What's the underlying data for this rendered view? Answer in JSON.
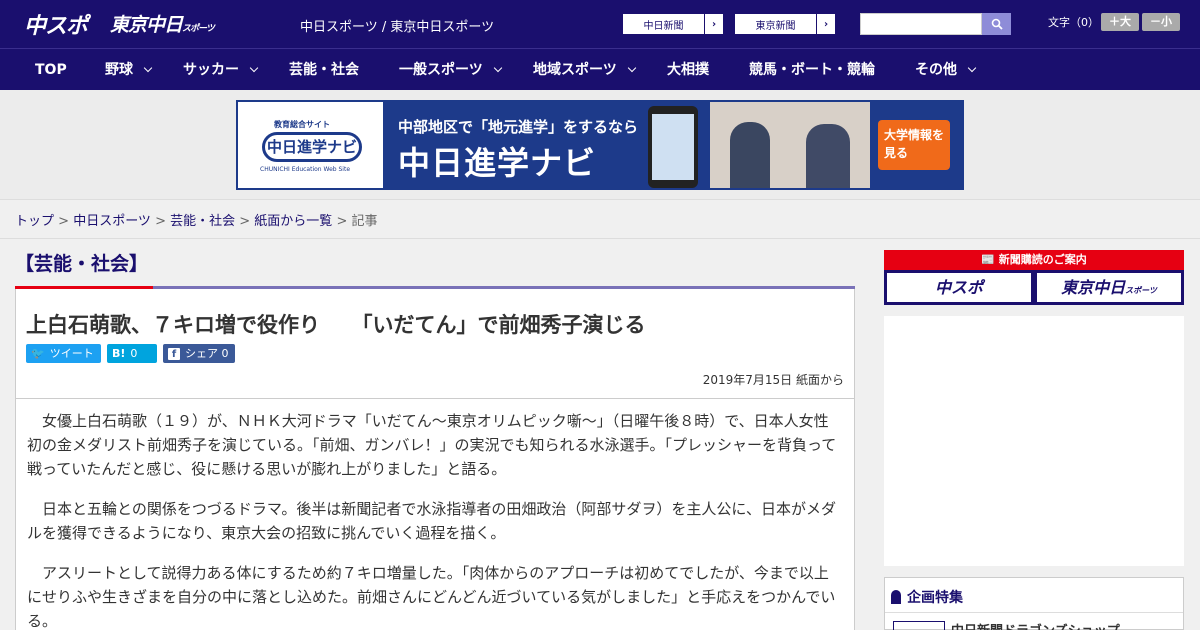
{
  "header": {
    "logo_chuspo": "中スポ",
    "logo_tokyo": "東京中日",
    "logo_tokyo_sub": "スポーツ",
    "site_name": "中日スポーツ / 東京中日スポーツ",
    "partner_links": [
      "中日新聞",
      "東京新聞"
    ],
    "font_size_label": "文字（0）",
    "font_bigger": "＋大",
    "font_smaller": "－小"
  },
  "nav": {
    "items": [
      {
        "label": "TOP"
      },
      {
        "label": "野球"
      },
      {
        "label": "サッカー"
      },
      {
        "label": "芸能・社会"
      },
      {
        "label": "一般スポーツ"
      },
      {
        "label": "地域スポーツ"
      },
      {
        "label": "大相撲"
      },
      {
        "label": "競馬・ボート・競輪"
      },
      {
        "label": "その他"
      }
    ]
  },
  "banner": {
    "logo_top": "教育総合サイト",
    "logo": "中日進学ナビ",
    "logo_sub": "CHUNICHI Education Web Site",
    "text1": "中部地区で「地元進学」をするなら",
    "text2": "中日進学ナビ",
    "cta": "大学情報を見る"
  },
  "breadcrumb": {
    "items": [
      "トップ",
      "中日スポーツ",
      "芸能・社会",
      "紙面から一覧"
    ],
    "current": "記事",
    "separator": " > "
  },
  "section": {
    "title": "【芸能・社会】"
  },
  "article": {
    "headline": "上白石萌歌、７キロ増で役作り　　「いだてん」で前畑秀子演じる",
    "share": {
      "tweet": "ツイート",
      "hatena_count": "0",
      "facebook": "シェア",
      "facebook_count": "0"
    },
    "date": "2019年7月15日 紙面から",
    "paragraphs": [
      "女優上白石萌歌（１９）が、ＮＨＫ大河ドラマ「いだてん～東京オリムピック噺～」（日曜午後８時）で、日本人女性初の金メダリスト前畑秀子を演じている。「前畑、ガンバレ！」の実況でも知られる水泳選手。「プレッシャーを背負って戦っていたんだと感じ、役に懸ける思いが膨れ上がりました」と語る。",
      "日本と五輪との関係をつづるドラマ。後半は新聞記者で水泳指導者の田畑政治（阿部サダヲ）を主人公に、日本がメダルを獲得できるようになり、東京大会の招致に挑んでいく過程を描く。",
      "アスリートとして説得力ある体にするため約７キロ増量した。「肉体からのアプローチは初めてでしたが、今まで以上にせりふや生きざまを自分の中に落とし込めた。前畑さんにどんどん近づいている気がしました」と手応えをつかんでいる。"
    ]
  },
  "sidebar": {
    "subscribe_title": "新聞購読のご案内",
    "subscribe_chuspo": "中スポ",
    "subscribe_tokyo": "東京中日",
    "subscribe_tokyo_sub": "スポーツ",
    "feature_title": "企画特集",
    "feature_item": "中日新聞ドラゴンズショップ"
  },
  "colors": {
    "brand_navy": "#1a0f6e",
    "accent_red": "#e60012",
    "twitter_blue": "#1da1f2",
    "hatena_blue": "#00a4de",
    "facebook_blue": "#3b5998"
  },
  "icons": [
    "search-icon",
    "chevron-right-icon",
    "chevron-down-icon",
    "twitter-icon",
    "hatena-icon",
    "facebook-icon",
    "ribbon-icon",
    "newspaper-icon"
  ]
}
